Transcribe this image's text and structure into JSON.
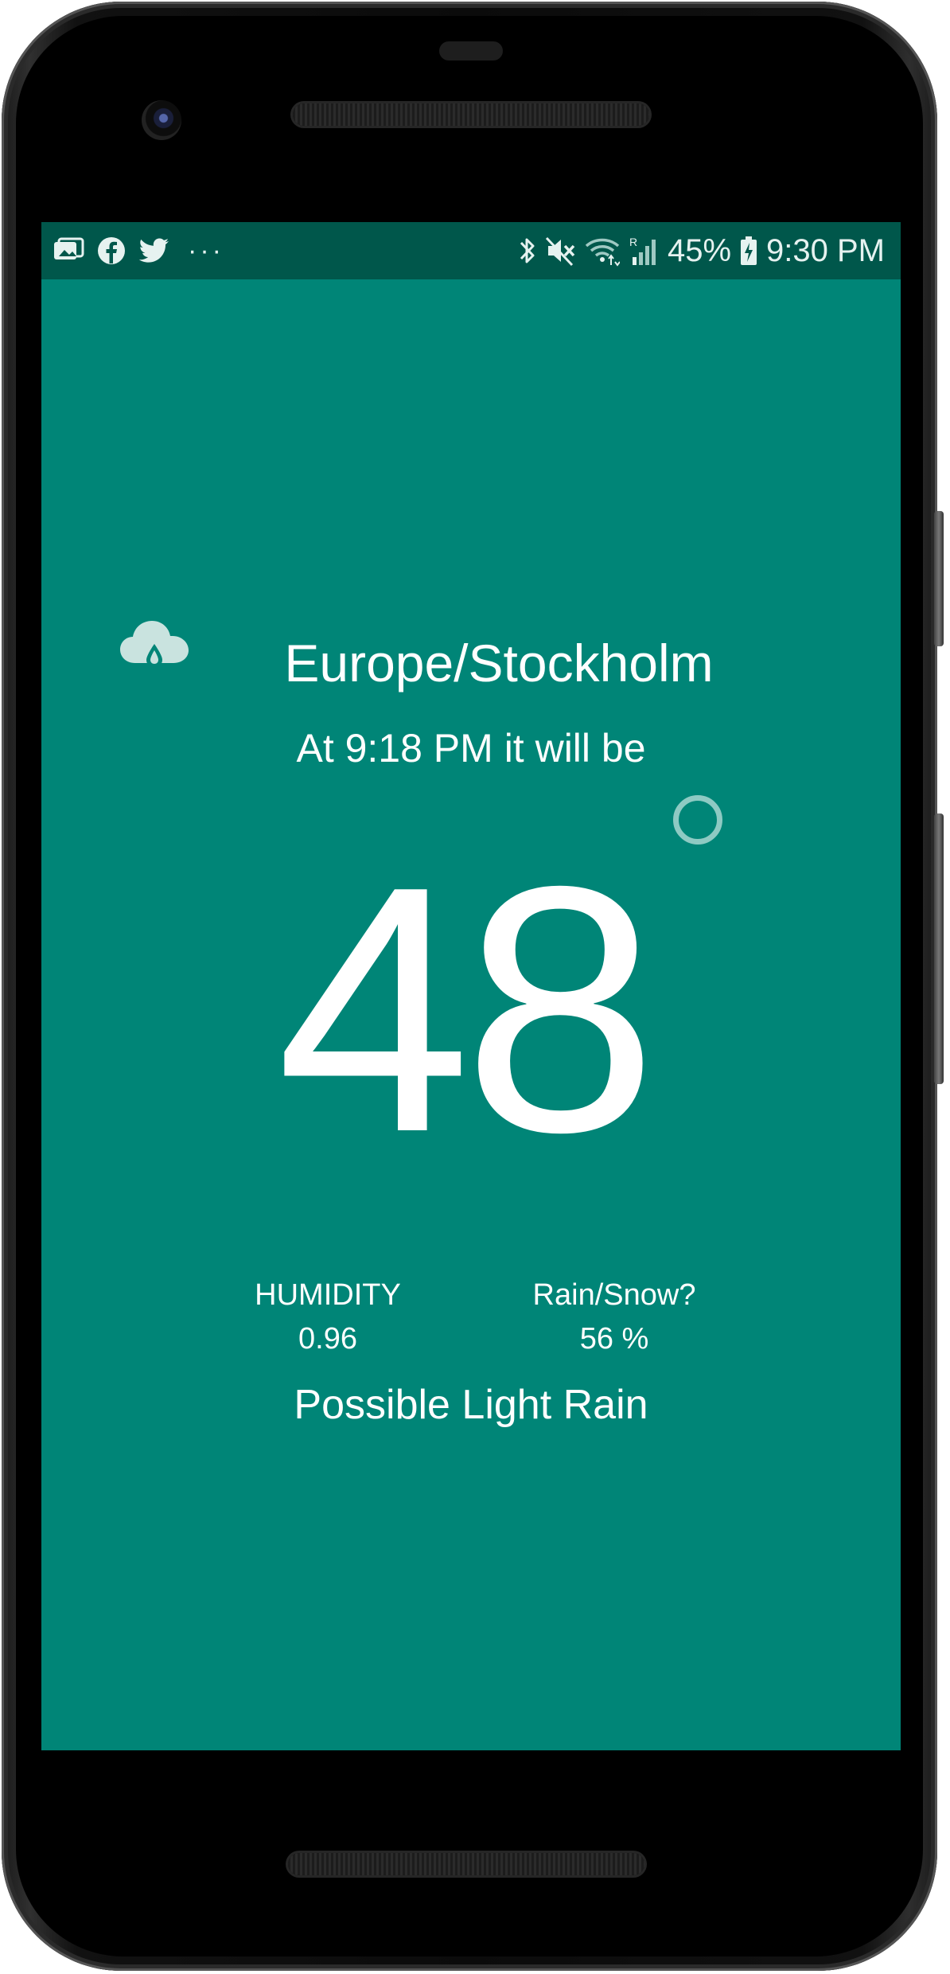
{
  "status_bar": {
    "battery": "45%",
    "time": "9:30 PM",
    "more_notifications": "···",
    "notification_icons": [
      "photo-notification-icon",
      "facebook-icon",
      "twitter-icon"
    ],
    "system_icons": [
      "bluetooth-icon",
      "mute-icon",
      "wifi-icon",
      "signal-icon",
      "battery-charging-icon"
    ]
  },
  "weather": {
    "icon": "rain-cloud-icon",
    "location": "Europe/Stockholm",
    "time_line": "At 9:18 PM it will be",
    "temperature": "48",
    "humidity_label": "HUMIDITY",
    "humidity_value": "0.96",
    "precip_label": "Rain/Snow?",
    "precip_value": "56 %",
    "summary": "Possible Light Rain"
  },
  "colors": {
    "background": "#008577",
    "status_bar": "#00574B",
    "text": "#FFFFFF"
  }
}
